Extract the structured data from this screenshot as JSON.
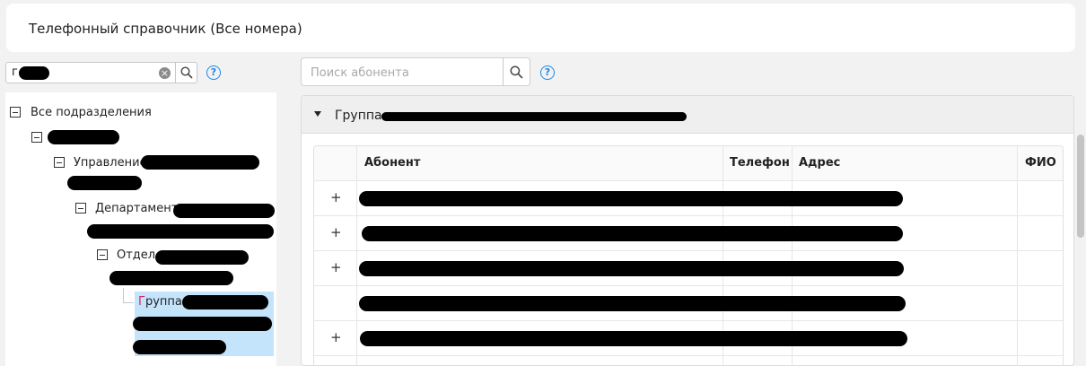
{
  "header": {
    "title": "Телефонный справочник (Все номера)"
  },
  "left_search": {
    "value": "г"
  },
  "right_search": {
    "placeholder": "Поиск абонента"
  },
  "help_label": "?",
  "clear_label": "×",
  "tree": {
    "root": "Все подразделения",
    "management": "Управление",
    "department": "Департамент",
    "division": "Отдел",
    "group": "Группа"
  },
  "group_header": {
    "label": "Группа"
  },
  "table": {
    "columns": [
      "Абонент",
      "Телефон",
      "Адрес",
      "ФИО"
    ],
    "row_expanders": [
      "+",
      "+",
      "+",
      "",
      "+",
      "+"
    ]
  },
  "icons": [
    "search-icon",
    "clear-icon",
    "help-icon",
    "collapse-icon",
    "caret-down-icon",
    "expand-icon"
  ],
  "colors": {
    "selection": "#c4e4fb",
    "accent": "#1e88e5",
    "match_highlight": "#e0245e"
  }
}
